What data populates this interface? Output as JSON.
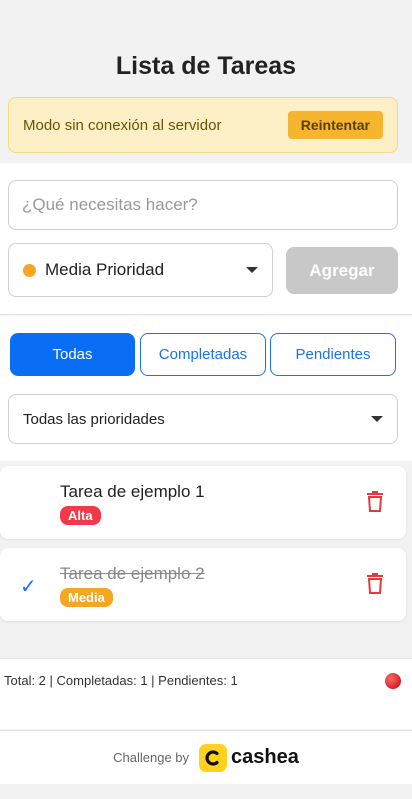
{
  "header": {
    "title": "Lista de Tareas"
  },
  "offline_banner": {
    "message": "Modo sin conexión al servidor",
    "retry_label": "Reintentar"
  },
  "form": {
    "task_placeholder": "¿Qué necesitas hacer?",
    "priority_selected": "Media Prioridad",
    "priority_dot_color": "#f5a623",
    "add_label": "Agregar"
  },
  "filters": {
    "tabs": [
      {
        "label": "Todas",
        "active": true
      },
      {
        "label": "Completadas",
        "active": false
      },
      {
        "label": "Pendientes",
        "active": false
      }
    ],
    "priority_filter": "Todas las prioridades"
  },
  "tasks": [
    {
      "title": "Tarea de ejemplo 1",
      "priority": "Alta",
      "completed": false
    },
    {
      "title": "Tarea de ejemplo 2",
      "priority": "Media",
      "completed": true
    }
  ],
  "stats": {
    "text": "Total: 2 | Completadas: 1 | Pendientes: 1"
  },
  "footer": {
    "challenge_label": "Challenge by",
    "brand": "cashea",
    "brand_color": "#ffd21f"
  },
  "colors": {
    "accent": "#0a6ef5",
    "danger": "#f03a4a",
    "warning": "#f5a623"
  }
}
